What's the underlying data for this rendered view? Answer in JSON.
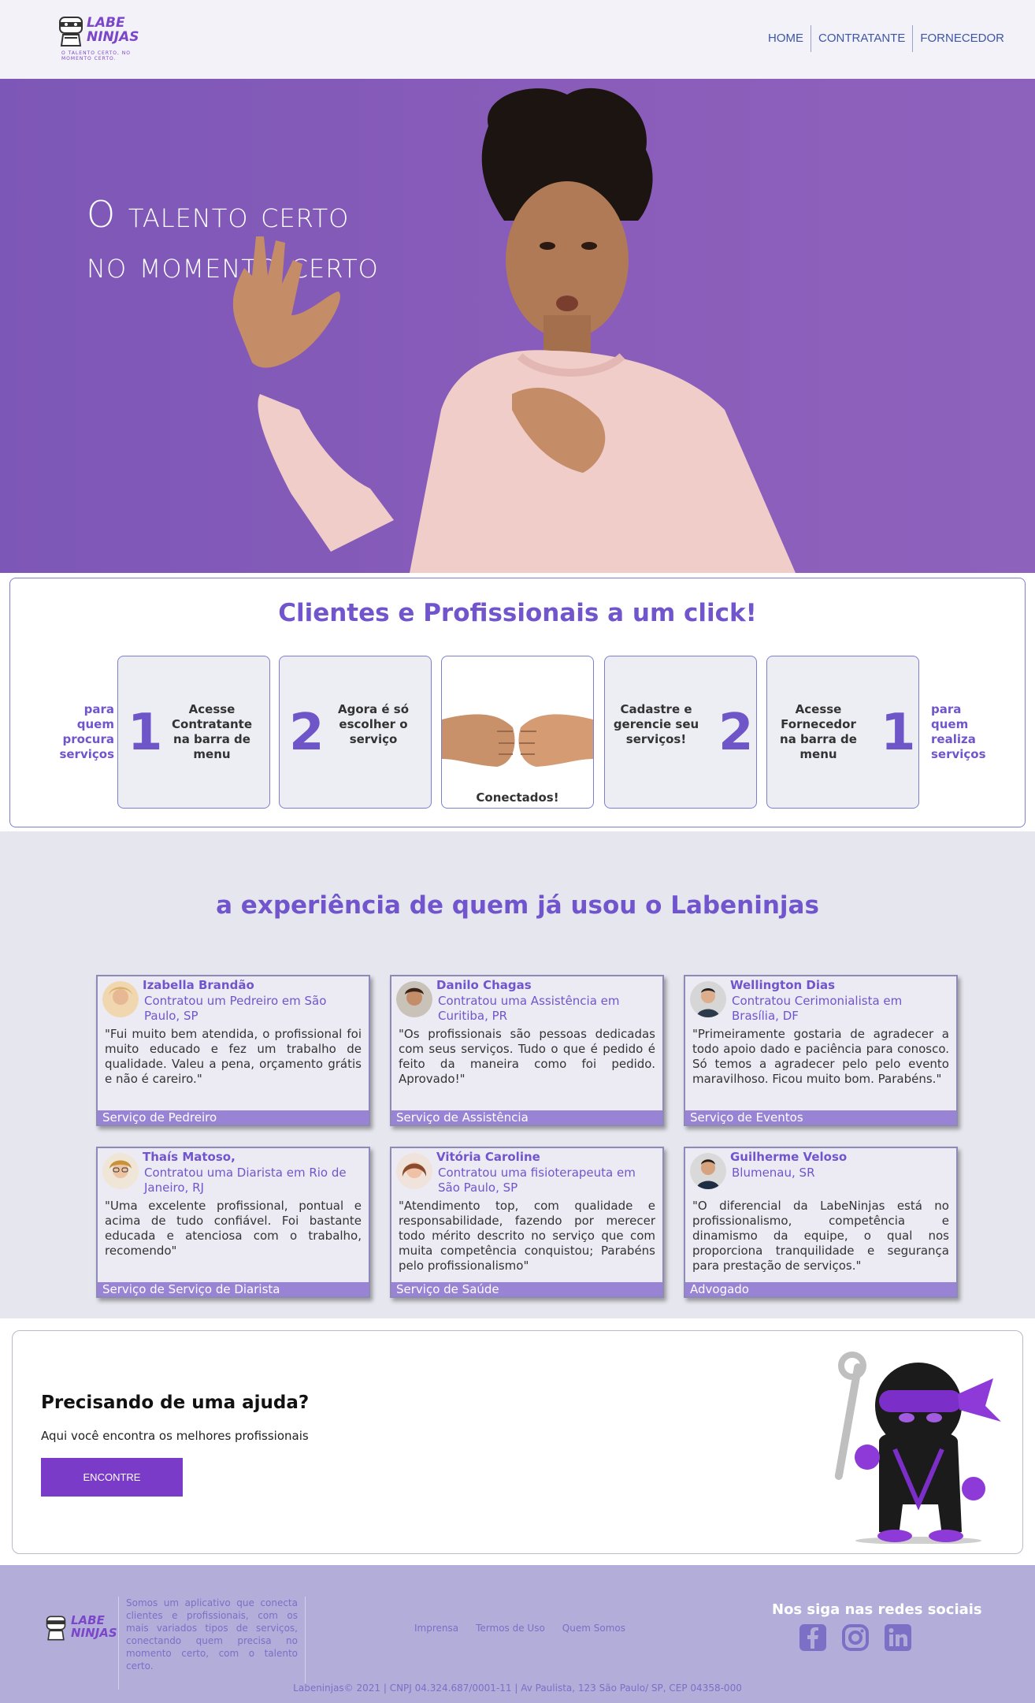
{
  "header": {
    "logo_text_line1": "LABE",
    "logo_text_line2": "NINJAS",
    "logo_tagline": "O TALENTO CERTO, NO MOMENTO CERTO.",
    "nav": [
      "HOME",
      "CONTRATANTE",
      "FORNECEDOR"
    ]
  },
  "hero": {
    "title_line1": "O talento certo",
    "title_line2": "no momento certo"
  },
  "steps": {
    "title": "Clientes e Profissionais a um click!",
    "left_side": "para quem procura serviços",
    "right_side": "para quem realiza serviços",
    "cards": [
      {
        "num": "1",
        "text": "Acesse Contratante na barra de menu"
      },
      {
        "num": "2",
        "text": "Agora é só escolher o serviço"
      },
      {
        "center_label": "Conectados!"
      },
      {
        "num": "2",
        "text": "Cadastre e gerencie seu serviços!"
      },
      {
        "num": "1",
        "text": "Acesse Fornecedor na barra de menu"
      }
    ]
  },
  "testimonials": {
    "title": "a experiência de quem já usou o Labeninjas",
    "items": [
      {
        "name": "Izabella Brandão",
        "sub": "Contratou um Pedreiro em São Paulo, SP",
        "quote": "\"Fui muito bem atendida, o profissional foi muito educado e fez um trabalho de qualidade. Valeu a pena, orçamento grátis e não é careiro.\"",
        "footer": "Serviço de Pedreiro"
      },
      {
        "name": "Danilo Chagas",
        "sub": "Contratou uma Assistência em Curitiba, PR",
        "quote": "\"Os profissionais são pessoas dedicadas com seus serviços. Tudo o que é pedido é feito da maneira como foi pedido. Aprovado!\"",
        "footer": "Serviço de Assistência"
      },
      {
        "name": "Wellington Dias",
        "sub": "Contratou Cerimonialista em Brasília, DF",
        "quote": "\"Primeiramente gostaria de agradecer a todo apoio dado e paciência para conosco. Só temos a agradecer pelo pelo evento maravilhoso. Ficou muito bom. Parabéns.\"",
        "footer": "Serviço de Eventos"
      },
      {
        "name": "Thaís Matoso,",
        "sub": "Contratou uma Diarista em Rio de Janeiro, RJ",
        "quote": "\"Uma excelente profissional, pontual e acima de tudo confiável. Foi bastante educada e atenciosa com o trabalho, recomendo\"",
        "footer": "Serviço de Serviço de Diarista"
      },
      {
        "name": "Vitória Caroline",
        "sub": "Contratou uma fisioterapeuta em São Paulo, SP",
        "quote": "\"Atendimento top, com qualidade e responsabilidade, fazendo por merecer todo mérito descrito no serviço que com muita competência conquistou; Parabéns pelo profissionalismo\"",
        "footer": "Serviço de Saúde"
      },
      {
        "name": "Guilherme Veloso",
        "sub": "Blumenau, SR",
        "quote": "\"O diferencial da LabeNinjas está no profissionalismo, competência e dinamismo da equipe, o qual nos proporciona tranquilidade e segurança para prestação de serviços.\"",
        "footer": "Advogado"
      }
    ]
  },
  "help": {
    "title": "Precisando de uma ajuda?",
    "subtitle": "Aqui você encontra os melhores profissionais",
    "button": "ENCONTRE"
  },
  "footer": {
    "description": "Somos um aplicativo que conecta clientes e profissionais, com os mais variados tipos de serviços, conectando quem precisa no momento certo, com o talento certo.",
    "links": [
      "Imprensa",
      "Termos de Uso",
      "Quem Somos"
    ],
    "social_title": "Nos siga nas redes sociais",
    "copyright": "Labeninjas© 2021 | CNPJ 04.324.687/0001-11 | Av Paulista, 123 São Paulo/ SP, CEP 04358-000"
  },
  "colors": {
    "accent": "#7155cc",
    "hero_bg": "#8a5dba",
    "footer_bg": "#b3aed9",
    "button": "#7a3bc8"
  }
}
